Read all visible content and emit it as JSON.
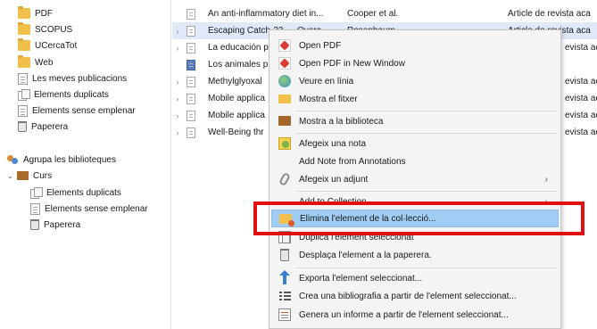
{
  "left_pane": {
    "items": [
      {
        "label": "PDF",
        "icon": "folder-icon"
      },
      {
        "label": "SCOPUS",
        "icon": "folder-icon"
      },
      {
        "label": "UCercaTot",
        "icon": "folder-icon"
      },
      {
        "label": "Web",
        "icon": "folder-icon"
      },
      {
        "label": "Les meves publicacions",
        "icon": "document-icon"
      },
      {
        "label": "Elements duplicats",
        "icon": "duplicates-icon"
      },
      {
        "label": "Elements sense emplenar",
        "icon": "document-icon"
      },
      {
        "label": "Paperera",
        "icon": "trash-icon"
      }
    ],
    "group_label": "Agrupa les biblioteques",
    "group_library": "Curs",
    "group_items": [
      {
        "label": "Elements duplicats",
        "icon": "duplicates-icon"
      },
      {
        "label": "Elements sense emplenar",
        "icon": "document-icon"
      },
      {
        "label": "Paperera",
        "icon": "trash-icon"
      }
    ]
  },
  "items_pane": {
    "rows": [
      {
        "title": "An anti-inflammatory diet in...",
        "creator": "Cooper et al.",
        "type": "Article de revista aca"
      },
      {
        "title": "Escaping Catch-22 — Overc...",
        "creator": "Rosenbaum",
        "type": "Article de revista aca",
        "selected": true
      },
      {
        "title": "La educación p",
        "creator": "",
        "type": "evista aca"
      },
      {
        "title": "Los animales p",
        "creator": "",
        "type": "",
        "icon": "book"
      },
      {
        "title": "Methylglyoxal",
        "creator": "",
        "type": "evista aca"
      },
      {
        "title": "Mobile applica",
        "creator": "",
        "type": "evista aca"
      },
      {
        "title": "Mobile applica",
        "creator": "",
        "type": "evista aca"
      },
      {
        "title": "Well-Being thr",
        "creator": "",
        "type": "evista aca"
      }
    ]
  },
  "context_menu": {
    "items": [
      {
        "label": "Open PDF",
        "icon": "pdf-icon"
      },
      {
        "label": "Open PDF in New Window",
        "icon": "pdf-icon"
      },
      {
        "label": "Veure en línia",
        "icon": "globe-icon"
      },
      {
        "label": "Mostra el fitxer",
        "icon": "folder-icon"
      },
      {
        "label": "Mostra a la biblioteca",
        "icon": "library-icon"
      },
      {
        "label": "Afegeix una nota",
        "icon": "note-icon"
      },
      {
        "label": "Add Note from Annotations",
        "icon": ""
      },
      {
        "label": "Afegeix un adjunt",
        "icon": "paperclip-icon",
        "submenu": true
      },
      {
        "label": "Add to Collection",
        "icon": "",
        "submenu": true
      },
      {
        "label": "Elimina l'element de la col·lecció...",
        "icon": "remove-from-collection-icon",
        "highlighted": true
      },
      {
        "label": "Duplica l'element seleccionat",
        "icon": "duplicate-icon"
      },
      {
        "label": "Desplaça l'element a la paperera.",
        "icon": "trash-icon"
      },
      {
        "label": "Exporta l'element seleccionat...",
        "icon": "export-icon"
      },
      {
        "label": "Crea una bibliografia a partir de l'element seleccionat...",
        "icon": "bibliography-icon"
      },
      {
        "label": "Genera un informe a partir de l'element seleccionat...",
        "icon": "report-icon"
      }
    ],
    "submenu_arrow": "›"
  },
  "colors": {
    "highlight_bg": "#9fcdf3",
    "annotation_box": "#e01010",
    "selected_row": "#dfe9f7"
  }
}
